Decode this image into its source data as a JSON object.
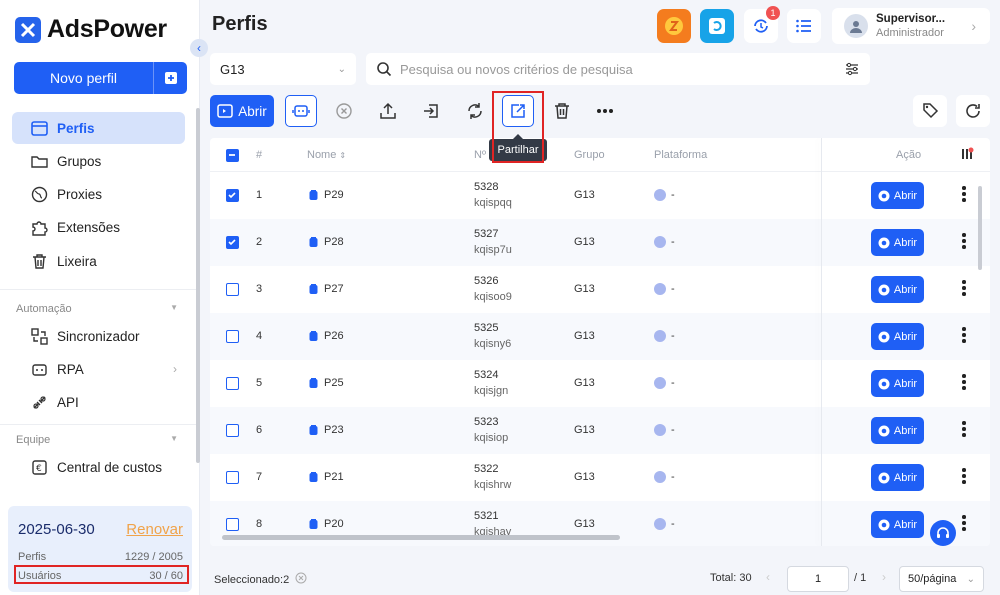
{
  "sidebar": {
    "brand": "AdsPower",
    "new_profile": "Novo perfil",
    "items": [
      {
        "label": "Perfis",
        "icon": "browser-window-icon",
        "active": true
      },
      {
        "label": "Grupos",
        "icon": "folder-icon"
      },
      {
        "label": "Proxies",
        "icon": "globe-icon"
      },
      {
        "label": "Extensões",
        "icon": "puzzle-icon"
      },
      {
        "label": "Lixeira",
        "icon": "trash-icon"
      }
    ],
    "section_automation": "Automação",
    "automation_items": [
      {
        "label": "Sincronizador",
        "icon": "sync-icon"
      },
      {
        "label": "RPA",
        "icon": "robot-icon"
      },
      {
        "label": "API",
        "icon": "api-icon"
      }
    ],
    "section_team": "Equipe",
    "team_items": [
      {
        "label": "Central de custos",
        "icon": "cost-center-icon"
      }
    ],
    "expiry_date": "2025-06-30",
    "renew": "Renovar",
    "profiles_label": "Perfis",
    "profiles_value": "1229 / 2005",
    "users_label": "Usuários",
    "users_value": "30 / 60"
  },
  "header": {
    "title": "Perfis",
    "notification_count": "1",
    "user_name": "Supervisor...",
    "user_role": "Administrador"
  },
  "filters": {
    "group_value": "G13",
    "search_placeholder": "Pesquisa ou novos critérios de pesquisa"
  },
  "toolbar": {
    "open_label": "Abrir",
    "tooltip": "Partilhar"
  },
  "table": {
    "columns": {
      "index": "#",
      "name": "Nome",
      "number": "Nº",
      "group": "Grupo",
      "platform": "Plataforma",
      "action": "Ação"
    },
    "open_label": "Abrir",
    "rows": [
      {
        "idx": "1",
        "name": "P29",
        "num": "5328",
        "code": "kqispqq",
        "group": "G13",
        "platform": "-",
        "checked": true
      },
      {
        "idx": "2",
        "name": "P28",
        "num": "5327",
        "code": "kqisp7u",
        "group": "G13",
        "platform": "-",
        "checked": true
      },
      {
        "idx": "3",
        "name": "P27",
        "num": "5326",
        "code": "kqisoo9",
        "group": "G13",
        "platform": "-",
        "checked": false
      },
      {
        "idx": "4",
        "name": "P26",
        "num": "5325",
        "code": "kqisny6",
        "group": "G13",
        "platform": "-",
        "checked": false
      },
      {
        "idx": "5",
        "name": "P25",
        "num": "5324",
        "code": "kqisjgn",
        "group": "G13",
        "platform": "-",
        "checked": false
      },
      {
        "idx": "6",
        "name": "P23",
        "num": "5323",
        "code": "kqisiop",
        "group": "G13",
        "platform": "-",
        "checked": false
      },
      {
        "idx": "7",
        "name": "P21",
        "num": "5322",
        "code": "kqishrw",
        "group": "G13",
        "platform": "-",
        "checked": false
      },
      {
        "idx": "8",
        "name": "P20",
        "num": "5321",
        "code": "kqishay",
        "group": "G13",
        "platform": "-",
        "checked": false
      }
    ]
  },
  "footer": {
    "selected": "Seleccionado:2",
    "total": "Total: 30",
    "page_value": "1",
    "page_of": "/ 1",
    "per_page": "50/página"
  },
  "colors": {
    "primary": "#1f5ff5",
    "highlight": "#e02424",
    "accent_orange": "#f0a34a"
  }
}
